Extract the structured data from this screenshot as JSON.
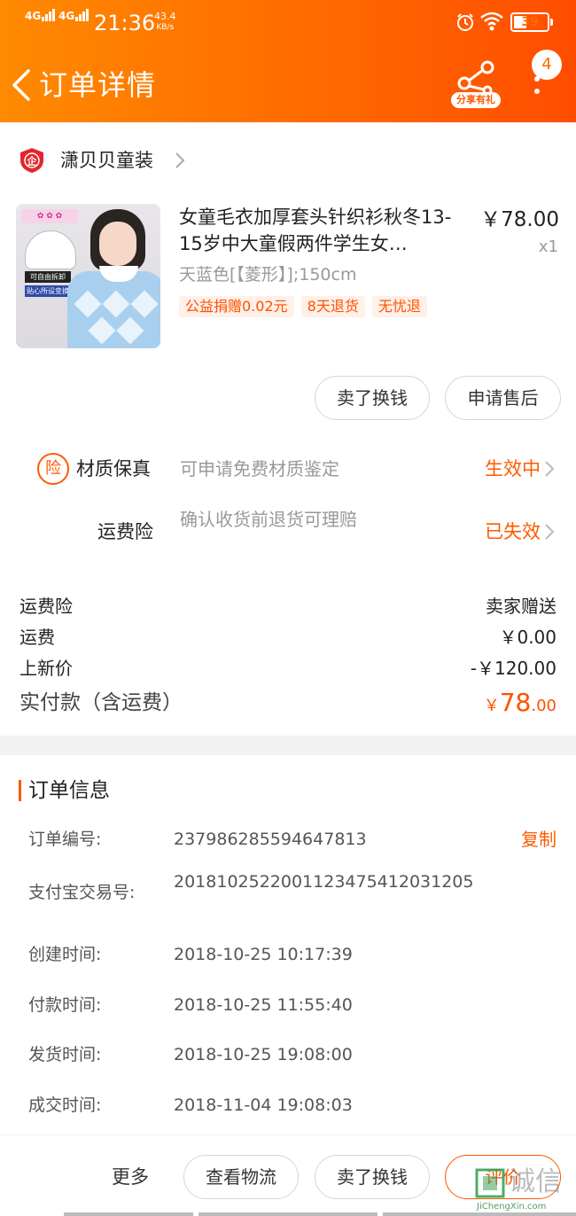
{
  "status_bar": {
    "signal1": "4G",
    "signal2": "4G",
    "time": "21:36",
    "speed_value": "43.4",
    "speed_unit": "KB/s",
    "battery": "39",
    "battery_level": 0.39
  },
  "header": {
    "title": "订单详情",
    "share_label": "分享有礼",
    "badge_count": "4",
    "accent": "#ff6a00"
  },
  "shop": {
    "name": "潇贝贝童装",
    "icon": "enterprise-shield-icon"
  },
  "product": {
    "title": "女童毛衣加厚套头针织衫秋冬13-15岁中大童假两件学生女…",
    "price": "￥78.00",
    "quantity": "x1",
    "sku": "天蓝色[【菱形】];150cm",
    "tags": [
      "公益捐赠0.02元",
      "8天退货",
      "无忧退"
    ],
    "image_tags": [
      "可自由拆卸",
      "贴心所设变换"
    ]
  },
  "item_actions": {
    "sell_exchange": "卖了换钱",
    "after_sale": "申请售后"
  },
  "insurance": [
    {
      "icon": "险",
      "name": "材质保真",
      "desc": "可申请免费材质鉴定",
      "status": "生效中"
    },
    {
      "icon": "",
      "name": "运费险",
      "desc": "确认收货前退货可理赔",
      "status": "已失效"
    }
  ],
  "summary": {
    "rows": [
      {
        "label": "运费险",
        "value": "卖家赠送"
      },
      {
        "label": "运费",
        "value": "￥0.00"
      },
      {
        "label": "上新价",
        "value": "-￥120.00"
      }
    ],
    "total_label": "实付款（含运费）",
    "total_currency": "￥",
    "total_int": "78",
    "total_dec": ".00"
  },
  "order_info": {
    "title": "订单信息",
    "copy_label": "复制",
    "rows": [
      {
        "label": "订单编号:",
        "value": "237986285594647813"
      },
      {
        "label": "支付宝交易号:",
        "value": "2018102522001123475412031205"
      },
      {
        "label": "创建时间:",
        "value": "2018-10-25 10:17:39"
      },
      {
        "label": "付款时间:",
        "value": "2018-10-25 11:55:40"
      },
      {
        "label": "发货时间:",
        "value": "2018-10-25 19:08:00"
      },
      {
        "label": "成交时间:",
        "value": "2018-11-04 19:08:03"
      }
    ]
  },
  "bottom_bar": {
    "more": "更多",
    "logistics": "查看物流",
    "sell_exchange": "卖了换钱",
    "review": "评价"
  },
  "watermark": {
    "text": "诚信",
    "url": "JiChengXin.com"
  }
}
